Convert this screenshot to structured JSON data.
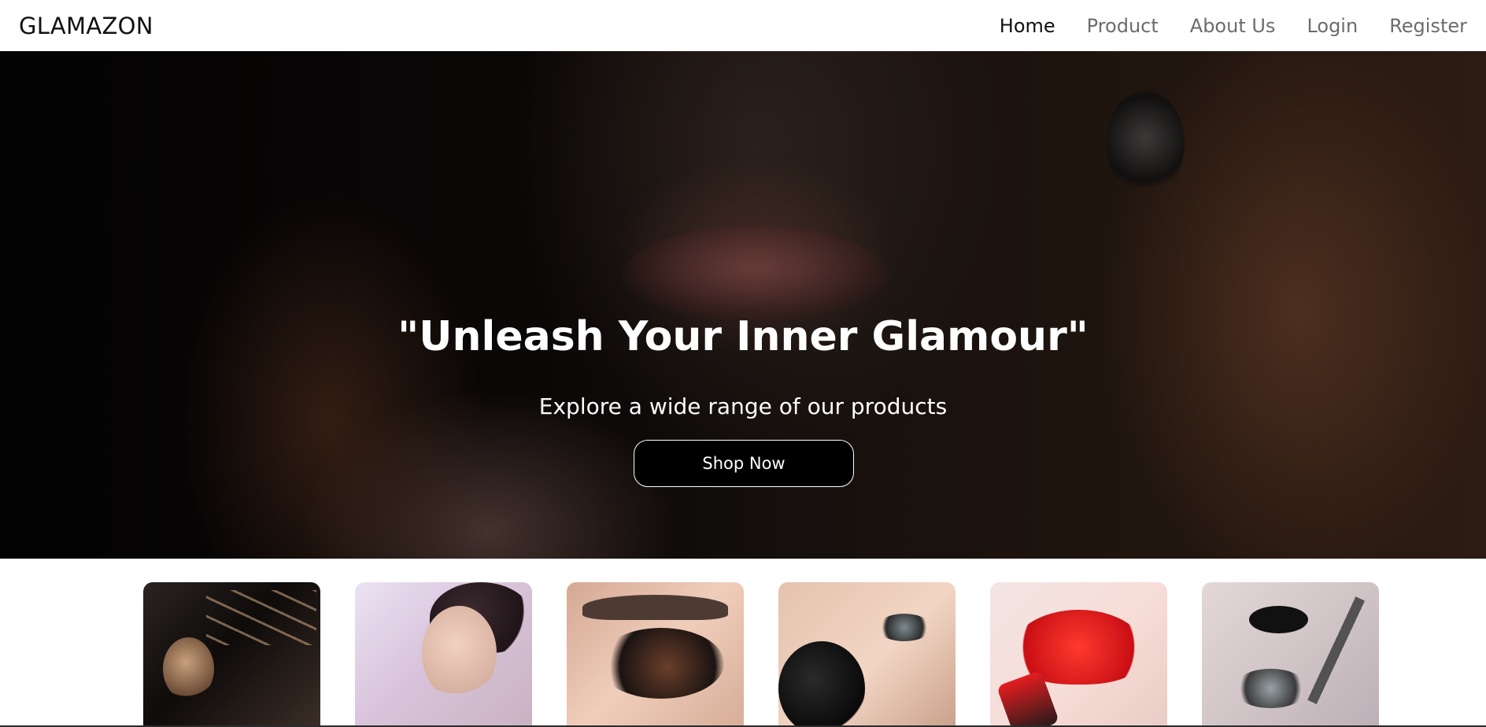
{
  "app": {
    "brand": "GLAMAZON"
  },
  "nav": {
    "items": [
      {
        "label": "Home"
      },
      {
        "label": "Product"
      },
      {
        "label": "About Us"
      },
      {
        "label": "Login"
      },
      {
        "label": "Register"
      }
    ]
  },
  "hero": {
    "title": "\"Unleash Your Inner Glamour\"",
    "subtitle": "Explore a wide range of our products",
    "cta_label": "Shop Now"
  },
  "colors": {
    "accent": "#000000",
    "nav_active": "#111111",
    "nav_inactive": "#6c6c6c",
    "hero_text": "#ffffff"
  }
}
